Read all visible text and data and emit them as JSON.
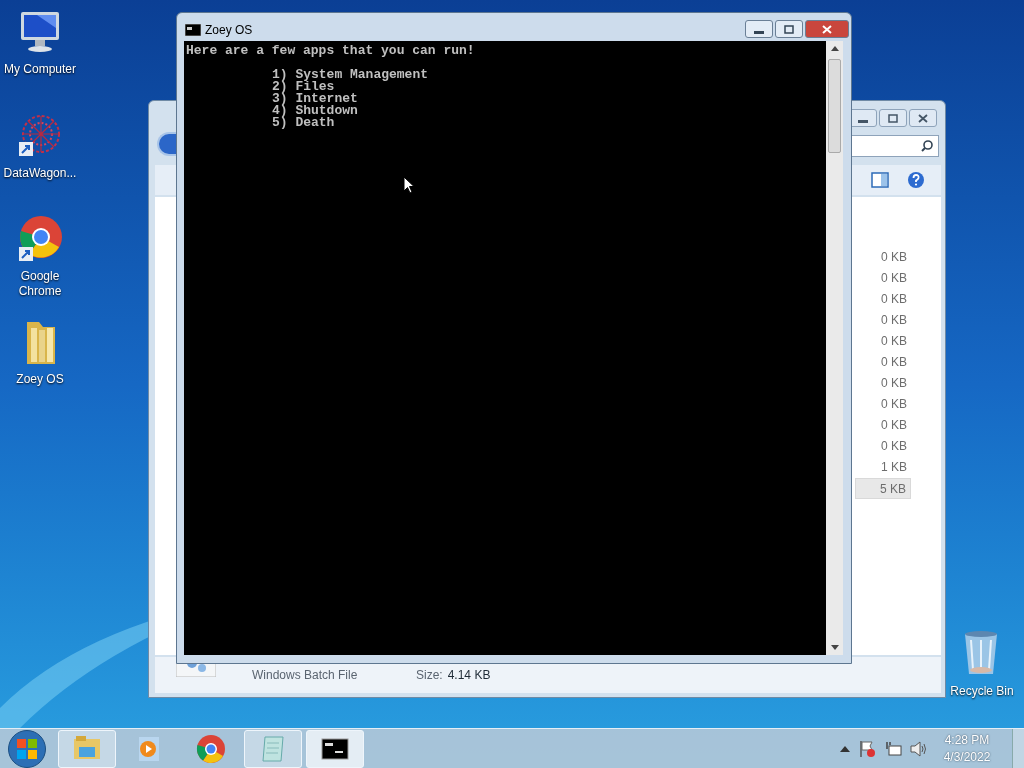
{
  "desktop_icons": [
    {
      "label": "My Computer",
      "kind": "computer"
    },
    {
      "label": "DataWagon...",
      "kind": "datawagon"
    },
    {
      "label": "Google Chrome",
      "kind": "chrome"
    },
    {
      "label": "Zoey OS",
      "kind": "folder"
    },
    {
      "label": "Recycle Bin",
      "kind": "recycle"
    }
  ],
  "explorer_window": {
    "size_column": [
      {
        "text": "0 KB",
        "selected": false
      },
      {
        "text": "0 KB",
        "selected": false
      },
      {
        "text": "0 KB",
        "selected": false
      },
      {
        "text": "0 KB",
        "selected": false
      },
      {
        "text": "0 KB",
        "selected": false
      },
      {
        "text": "0 KB",
        "selected": false
      },
      {
        "text": "0 KB",
        "selected": false
      },
      {
        "text": "0 KB",
        "selected": false
      },
      {
        "text": "0 KB",
        "selected": false
      },
      {
        "text": "0 KB",
        "selected": false
      },
      {
        "text": "1 KB",
        "selected": false
      },
      {
        "text": "5 KB",
        "selected": true
      }
    ],
    "details_pane": {
      "file_type": "Windows Batch File",
      "size_label": "Size:",
      "size_value": "4.14 KB"
    }
  },
  "console_window": {
    "title": "Zoey OS",
    "heading": "Here are a few apps that you can run!",
    "options": [
      "1) System Management",
      "2) Files",
      "3) Internet",
      "4) Shutdown",
      "5) Death"
    ]
  },
  "taskbar": {
    "items": [
      {
        "kind": "explorer",
        "running": true,
        "active": false
      },
      {
        "kind": "media",
        "running": false,
        "active": false
      },
      {
        "kind": "chrome",
        "running": false,
        "active": false
      },
      {
        "kind": "notepad",
        "running": true,
        "active": false
      },
      {
        "kind": "console",
        "running": true,
        "active": true
      }
    ],
    "clock": {
      "time": "4:28 PM",
      "date": "4/3/2022"
    }
  }
}
